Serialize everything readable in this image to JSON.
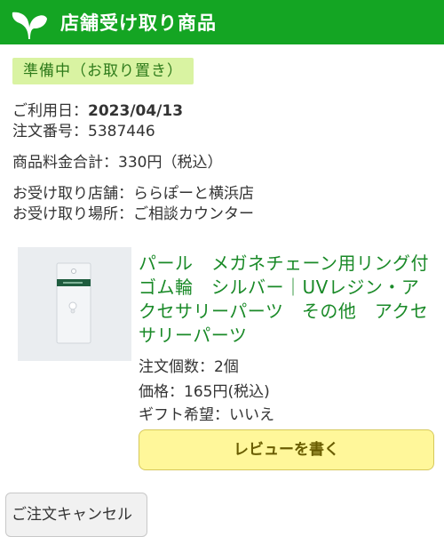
{
  "header": {
    "title": "店舗受け取り商品",
    "icon": "leaf-icon",
    "color": "#14a523"
  },
  "status": {
    "label": "準備中（お取り置き）"
  },
  "order": {
    "use_date_label": "ご利用日：",
    "use_date_value": "2023/04/13",
    "order_number": "注文番号：5387446",
    "total": "商品料金合計：330円（税込）",
    "pickup_store": "お受け取り店舗：ららぽーと横浜店",
    "pickup_location": "お受け取り場所：ご相談カウンター"
  },
  "product": {
    "image_alt": "product-thumbnail",
    "title": "パール　メガネチェーン用リング付ゴム輪　シルバー｜UVレジン・アクセサリーパーツ　その他　アクセサリーパーツ",
    "quantity": "注文個数：2個",
    "price": "価格：165円(税込)",
    "gift": "ギフト希望：いいえ",
    "review_button": "レビューを書く"
  },
  "actions": {
    "cancel_button": "ご注文キャンセル"
  }
}
